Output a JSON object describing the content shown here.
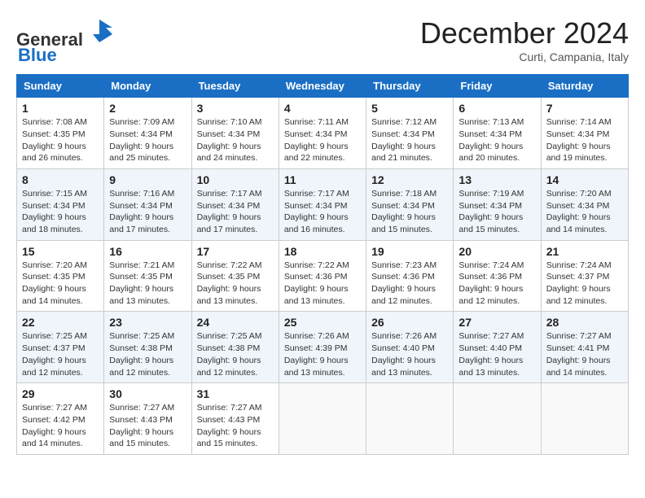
{
  "header": {
    "logo_line1": "General",
    "logo_line2": "Blue",
    "month_title": "December 2024",
    "location": "Curti, Campania, Italy"
  },
  "weekdays": [
    "Sunday",
    "Monday",
    "Tuesday",
    "Wednesday",
    "Thursday",
    "Friday",
    "Saturday"
  ],
  "weeks": [
    [
      {
        "day": "1",
        "sunrise": "7:08 AM",
        "sunset": "4:35 PM",
        "daylight": "9 hours and 26 minutes."
      },
      {
        "day": "2",
        "sunrise": "7:09 AM",
        "sunset": "4:34 PM",
        "daylight": "9 hours and 25 minutes."
      },
      {
        "day": "3",
        "sunrise": "7:10 AM",
        "sunset": "4:34 PM",
        "daylight": "9 hours and 24 minutes."
      },
      {
        "day": "4",
        "sunrise": "7:11 AM",
        "sunset": "4:34 PM",
        "daylight": "9 hours and 22 minutes."
      },
      {
        "day": "5",
        "sunrise": "7:12 AM",
        "sunset": "4:34 PM",
        "daylight": "9 hours and 21 minutes."
      },
      {
        "day": "6",
        "sunrise": "7:13 AM",
        "sunset": "4:34 PM",
        "daylight": "9 hours and 20 minutes."
      },
      {
        "day": "7",
        "sunrise": "7:14 AM",
        "sunset": "4:34 PM",
        "daylight": "9 hours and 19 minutes."
      }
    ],
    [
      {
        "day": "8",
        "sunrise": "7:15 AM",
        "sunset": "4:34 PM",
        "daylight": "9 hours and 18 minutes."
      },
      {
        "day": "9",
        "sunrise": "7:16 AM",
        "sunset": "4:34 PM",
        "daylight": "9 hours and 17 minutes."
      },
      {
        "day": "10",
        "sunrise": "7:17 AM",
        "sunset": "4:34 PM",
        "daylight": "9 hours and 17 minutes."
      },
      {
        "day": "11",
        "sunrise": "7:17 AM",
        "sunset": "4:34 PM",
        "daylight": "9 hours and 16 minutes."
      },
      {
        "day": "12",
        "sunrise": "7:18 AM",
        "sunset": "4:34 PM",
        "daylight": "9 hours and 15 minutes."
      },
      {
        "day": "13",
        "sunrise": "7:19 AM",
        "sunset": "4:34 PM",
        "daylight": "9 hours and 15 minutes."
      },
      {
        "day": "14",
        "sunrise": "7:20 AM",
        "sunset": "4:34 PM",
        "daylight": "9 hours and 14 minutes."
      }
    ],
    [
      {
        "day": "15",
        "sunrise": "7:20 AM",
        "sunset": "4:35 PM",
        "daylight": "9 hours and 14 minutes."
      },
      {
        "day": "16",
        "sunrise": "7:21 AM",
        "sunset": "4:35 PM",
        "daylight": "9 hours and 13 minutes."
      },
      {
        "day": "17",
        "sunrise": "7:22 AM",
        "sunset": "4:35 PM",
        "daylight": "9 hours and 13 minutes."
      },
      {
        "day": "18",
        "sunrise": "7:22 AM",
        "sunset": "4:36 PM",
        "daylight": "9 hours and 13 minutes."
      },
      {
        "day": "19",
        "sunrise": "7:23 AM",
        "sunset": "4:36 PM",
        "daylight": "9 hours and 12 minutes."
      },
      {
        "day": "20",
        "sunrise": "7:24 AM",
        "sunset": "4:36 PM",
        "daylight": "9 hours and 12 minutes."
      },
      {
        "day": "21",
        "sunrise": "7:24 AM",
        "sunset": "4:37 PM",
        "daylight": "9 hours and 12 minutes."
      }
    ],
    [
      {
        "day": "22",
        "sunrise": "7:25 AM",
        "sunset": "4:37 PM",
        "daylight": "9 hours and 12 minutes."
      },
      {
        "day": "23",
        "sunrise": "7:25 AM",
        "sunset": "4:38 PM",
        "daylight": "9 hours and 12 minutes."
      },
      {
        "day": "24",
        "sunrise": "7:25 AM",
        "sunset": "4:38 PM",
        "daylight": "9 hours and 12 minutes."
      },
      {
        "day": "25",
        "sunrise": "7:26 AM",
        "sunset": "4:39 PM",
        "daylight": "9 hours and 13 minutes."
      },
      {
        "day": "26",
        "sunrise": "7:26 AM",
        "sunset": "4:40 PM",
        "daylight": "9 hours and 13 minutes."
      },
      {
        "day": "27",
        "sunrise": "7:27 AM",
        "sunset": "4:40 PM",
        "daylight": "9 hours and 13 minutes."
      },
      {
        "day": "28",
        "sunrise": "7:27 AM",
        "sunset": "4:41 PM",
        "daylight": "9 hours and 14 minutes."
      }
    ],
    [
      {
        "day": "29",
        "sunrise": "7:27 AM",
        "sunset": "4:42 PM",
        "daylight": "9 hours and 14 minutes."
      },
      {
        "day": "30",
        "sunrise": "7:27 AM",
        "sunset": "4:43 PM",
        "daylight": "9 hours and 15 minutes."
      },
      {
        "day": "31",
        "sunrise": "7:27 AM",
        "sunset": "4:43 PM",
        "daylight": "9 hours and 15 minutes."
      },
      null,
      null,
      null,
      null
    ]
  ]
}
